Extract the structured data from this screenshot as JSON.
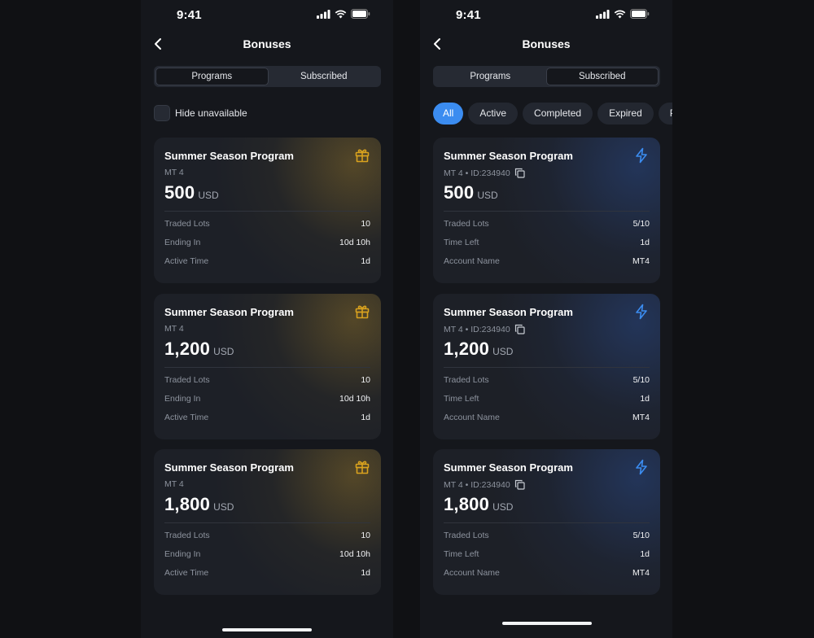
{
  "status": {
    "time": "9:41"
  },
  "left": {
    "nav_title": "Bonuses",
    "tabs": [
      "Programs",
      "Subscribed"
    ],
    "selected_tab": "Programs",
    "hide_unavailable_label": "Hide unavailable",
    "hide_unavailable_checked": false,
    "cards": [
      {
        "title": "Summer Season Program",
        "subtitle": "MT 4",
        "amount": "500",
        "currency": "USD",
        "icon": "gift-icon",
        "rows": [
          {
            "label": "Traded Lots",
            "value": "10"
          },
          {
            "label": "Ending In",
            "value": "10d 10h"
          },
          {
            "label": "Active Time",
            "value": "1d"
          }
        ]
      },
      {
        "title": "Summer Season Program",
        "subtitle": "MT 4",
        "amount": "1,200",
        "currency": "USD",
        "icon": "gift-icon",
        "rows": [
          {
            "label": "Traded Lots",
            "value": "10"
          },
          {
            "label": "Ending In",
            "value": "10d 10h"
          },
          {
            "label": "Active Time",
            "value": "1d"
          }
        ]
      },
      {
        "title": "Summer Season Program",
        "subtitle": "MT 4",
        "amount": "1,800",
        "currency": "USD",
        "icon": "gift-icon",
        "rows": [
          {
            "label": "Traded Lots",
            "value": "10"
          },
          {
            "label": "Ending In",
            "value": "10d 10h"
          },
          {
            "label": "Active Time",
            "value": "1d"
          }
        ]
      }
    ]
  },
  "right": {
    "nav_title": "Bonuses",
    "tabs": [
      "Programs",
      "Subscribed"
    ],
    "selected_tab": "Subscribed",
    "filters": [
      "All",
      "Active",
      "Completed",
      "Expired",
      "P"
    ],
    "active_filter": "All",
    "cards": [
      {
        "title": "Summer Season Program",
        "subtitle": "MT 4 • ID:234940",
        "amount": "500",
        "currency": "USD",
        "icon": "lightning-icon",
        "rows": [
          {
            "label": "Traded Lots",
            "value": "5/10"
          },
          {
            "label": "Time Left",
            "value": "1d"
          },
          {
            "label": "Account Name",
            "value": "MT4"
          }
        ]
      },
      {
        "title": "Summer Season Program",
        "subtitle": "MT 4 • ID:234940",
        "amount": "1,200",
        "currency": "USD",
        "icon": "lightning-icon",
        "rows": [
          {
            "label": "Traded Lots",
            "value": "5/10"
          },
          {
            "label": "Time Left",
            "value": "1d"
          },
          {
            "label": "Account Name",
            "value": "MT4"
          }
        ]
      },
      {
        "title": "Summer Season Program",
        "subtitle": "MT 4 • ID:234940",
        "amount": "1,800",
        "currency": "USD",
        "icon": "lightning-icon",
        "rows": [
          {
            "label": "Traded Lots",
            "value": "5/10"
          },
          {
            "label": "Time Left",
            "value": "1d"
          },
          {
            "label": "Account Name",
            "value": "MT4"
          }
        ]
      }
    ]
  },
  "colors": {
    "background": "#101114",
    "phone_background": "#15171c",
    "card_background": "#1d2027",
    "accent_blue": "#3b8cf0",
    "gift_gold": "#d9a21e",
    "muted_text": "#8d939e"
  }
}
